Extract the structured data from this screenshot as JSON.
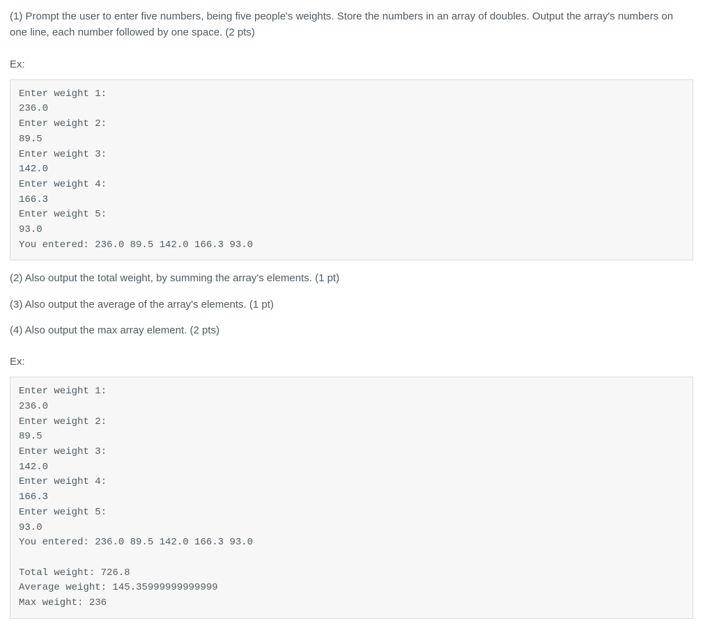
{
  "p1": "(1) Prompt the user to enter five numbers, being five people's weights. Store the numbers in an array of doubles. Output the array's numbers on one line, each number followed by one space. (2 pts)",
  "ex_label_1": "Ex:",
  "code1": "Enter weight 1:\n236.0\nEnter weight 2:\n89.5\nEnter weight 3:\n142.0\nEnter weight 4:\n166.3\nEnter weight 5:\n93.0\nYou entered: 236.0 89.5 142.0 166.3 93.0",
  "p2": "(2) Also output the total weight, by summing the array's elements. (1 pt)",
  "p3": "(3) Also output the average of the array's elements. (1 pt)",
  "p4": "(4) Also output the max array element. (2 pts)",
  "ex_label_2": "Ex:",
  "code2": "Enter weight 1:\n236.0\nEnter weight 2:\n89.5\nEnter weight 3:\n142.0\nEnter weight 4:\n166.3\nEnter weight 5:\n93.0\nYou entered: 236.0 89.5 142.0 166.3 93.0\n\nTotal weight: 726.8\nAverage weight: 145.35999999999999\nMax weight: 236"
}
